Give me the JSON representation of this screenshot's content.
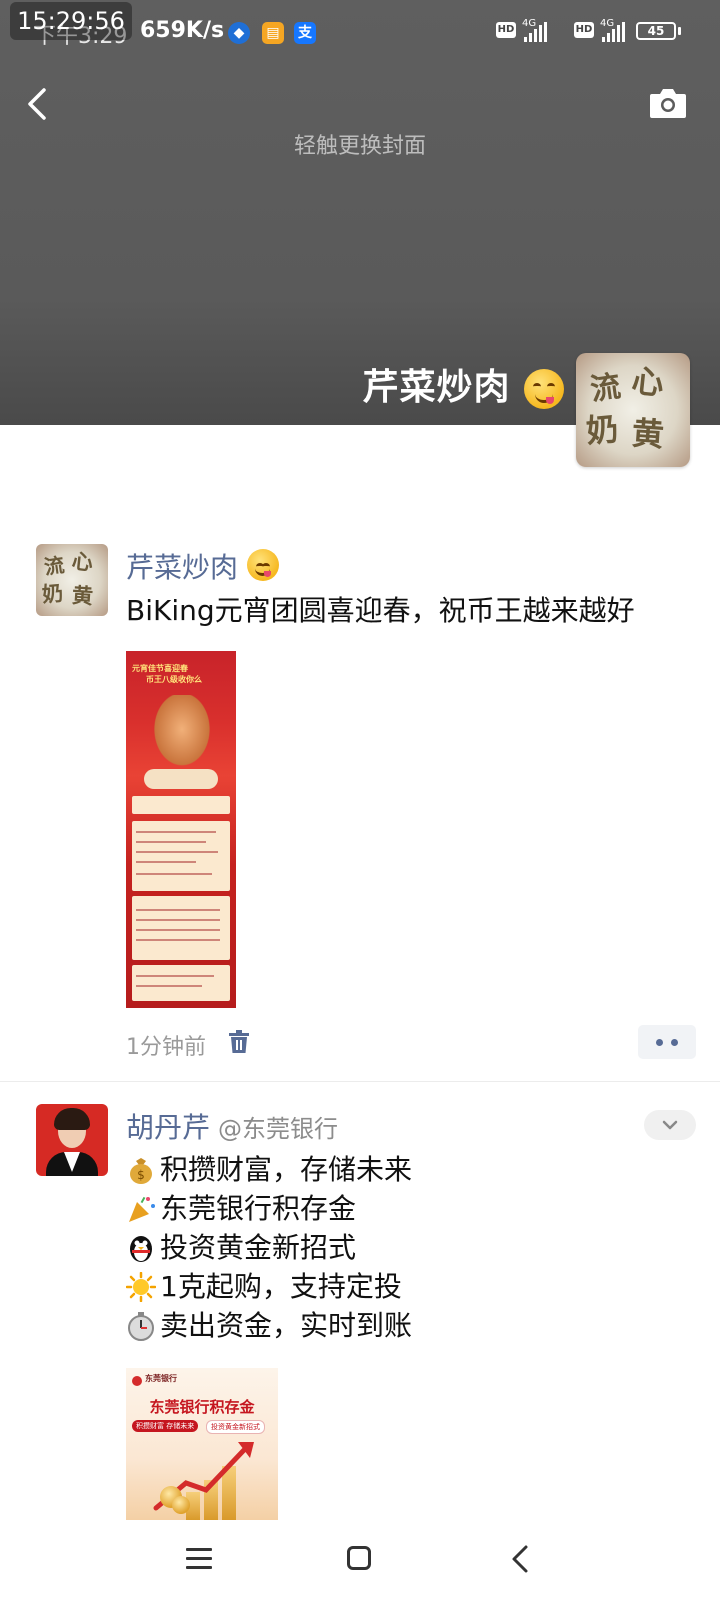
{
  "status_bar": {
    "clock": "15:29:56",
    "time": "下午3:29",
    "net_speed": "659K/s",
    "net1": "4G",
    "net2": "4G",
    "hd1": "HD",
    "hd2": "HD",
    "battery": "45",
    "alipay_glyph": "支"
  },
  "cover": {
    "hint": "轻触更换封面",
    "owner_name": "芹菜炒肉"
  },
  "avatar_art": {
    "chars": [
      "流",
      "心",
      "奶",
      "黄"
    ]
  },
  "posts": [
    {
      "author": "芹菜炒肉",
      "text": "BiKing元宵团圆喜迎春，祝币王越来越好",
      "image_text": [
        "元宵佳节喜迎春",
        "币王八级收你么"
      ],
      "time": "1分钟前"
    },
    {
      "author": "胡丹芹",
      "handle": "@东莞银行",
      "lines": [
        {
          "emoji": "money-bag",
          "text": "积攒财富，存储未来"
        },
        {
          "emoji": "party-popper",
          "text": "东莞银行积存金"
        },
        {
          "emoji": "penguin",
          "text": "投资黄金新招式"
        },
        {
          "emoji": "sun",
          "text": "1克起购，支持定投"
        },
        {
          "emoji": "stopwatch",
          "text": "卖出资金，实时到账"
        }
      ],
      "image": {
        "brand": "东莞银行",
        "title": "东莞银行积存金",
        "tag1": "积攒财富 存储未来",
        "tag2": "投资黄金新招式"
      }
    }
  ],
  "colors": {
    "link_blue": "#576b95",
    "cover_gray": "#5a5a5a",
    "poster_red": "#c8232a"
  }
}
